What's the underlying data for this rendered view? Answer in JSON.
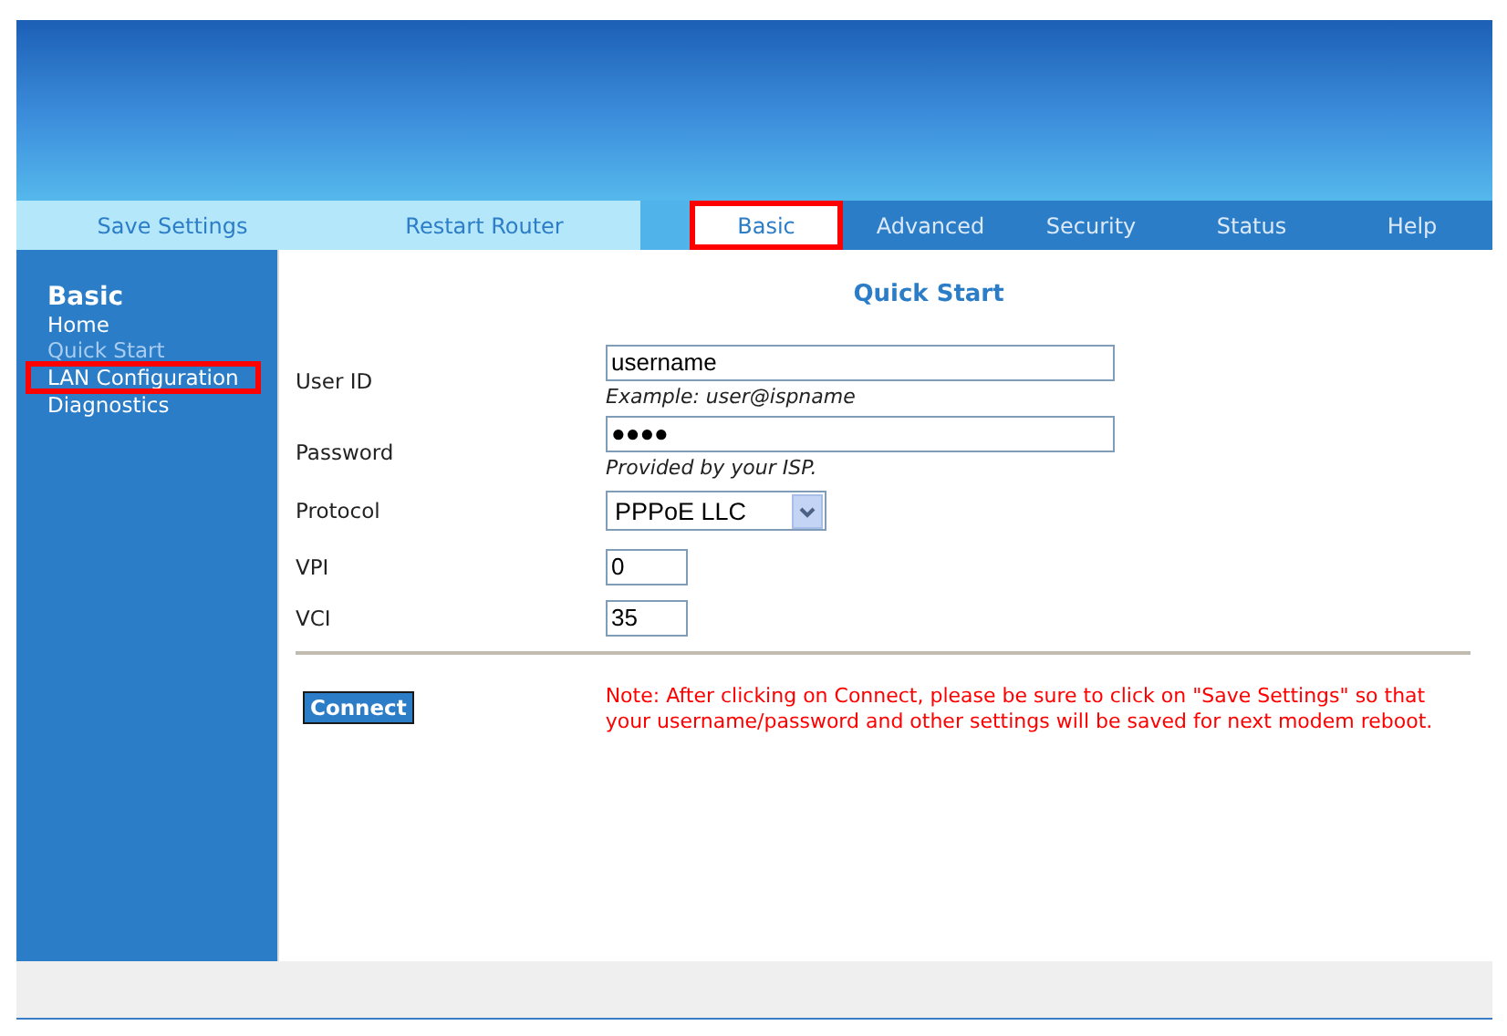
{
  "tabs": [
    {
      "label": "Save Settings",
      "kind": "utility",
      "selected": false,
      "highlighted": false
    },
    {
      "label": "Restart Router",
      "kind": "utility",
      "selected": false,
      "highlighted": false
    },
    {
      "label": "Basic",
      "kind": "section",
      "selected": true,
      "highlighted": true
    },
    {
      "label": "Advanced",
      "kind": "section",
      "selected": false,
      "highlighted": false
    },
    {
      "label": "Security",
      "kind": "section",
      "selected": false,
      "highlighted": false
    },
    {
      "label": "Status",
      "kind": "section",
      "selected": false,
      "highlighted": false
    },
    {
      "label": "Help",
      "kind": "section",
      "selected": false,
      "highlighted": false
    }
  ],
  "sidebar": {
    "heading": "Basic",
    "items": [
      {
        "label": "Home",
        "selected": false,
        "highlighted": false
      },
      {
        "label": "Quick Start",
        "selected": true,
        "highlighted": false
      },
      {
        "label": "LAN Configuration",
        "selected": false,
        "highlighted": true
      },
      {
        "label": "Diagnostics",
        "selected": false,
        "highlighted": false
      }
    ]
  },
  "form": {
    "title": "Quick Start",
    "fields": [
      {
        "label": "User ID",
        "kind": "text",
        "value": "username",
        "hint": "Example: user@ispname"
      },
      {
        "label": "Password",
        "kind": "text",
        "value": "●●●●",
        "hint": "Provided by your ISP."
      },
      {
        "label": "Protocol",
        "kind": "select",
        "value": "PPPoE LLC"
      },
      {
        "label": "VPI",
        "kind": "short",
        "value": "0"
      },
      {
        "label": "VCI",
        "kind": "short",
        "value": "35"
      }
    ],
    "button": "Connect",
    "note": "Note: After clicking on Connect, please be sure to click on \"Save Settings\" so that your username/password and other settings will be saved for next modem reboot."
  }
}
